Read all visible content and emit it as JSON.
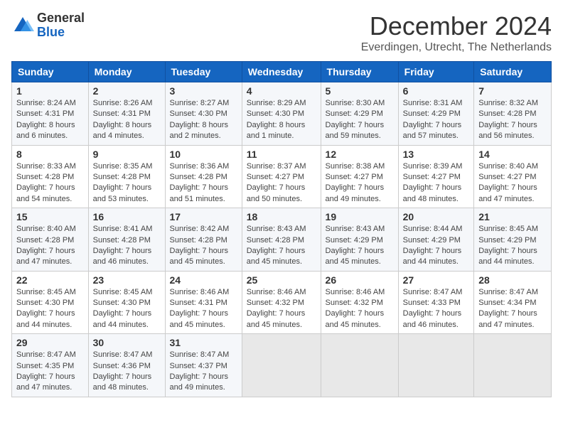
{
  "logo": {
    "general": "General",
    "blue": "Blue"
  },
  "title": "December 2024",
  "subtitle": "Everdingen, Utrecht, The Netherlands",
  "days_of_week": [
    "Sunday",
    "Monday",
    "Tuesday",
    "Wednesday",
    "Thursday",
    "Friday",
    "Saturday"
  ],
  "weeks": [
    [
      {
        "day": "1",
        "info": "Sunrise: 8:24 AM\nSunset: 4:31 PM\nDaylight: 8 hours\nand 6 minutes."
      },
      {
        "day": "2",
        "info": "Sunrise: 8:26 AM\nSunset: 4:31 PM\nDaylight: 8 hours\nand 4 minutes."
      },
      {
        "day": "3",
        "info": "Sunrise: 8:27 AM\nSunset: 4:30 PM\nDaylight: 8 hours\nand 2 minutes."
      },
      {
        "day": "4",
        "info": "Sunrise: 8:29 AM\nSunset: 4:30 PM\nDaylight: 8 hours\nand 1 minute."
      },
      {
        "day": "5",
        "info": "Sunrise: 8:30 AM\nSunset: 4:29 PM\nDaylight: 7 hours\nand 59 minutes."
      },
      {
        "day": "6",
        "info": "Sunrise: 8:31 AM\nSunset: 4:29 PM\nDaylight: 7 hours\nand 57 minutes."
      },
      {
        "day": "7",
        "info": "Sunrise: 8:32 AM\nSunset: 4:28 PM\nDaylight: 7 hours\nand 56 minutes."
      }
    ],
    [
      {
        "day": "8",
        "info": "Sunrise: 8:33 AM\nSunset: 4:28 PM\nDaylight: 7 hours\nand 54 minutes."
      },
      {
        "day": "9",
        "info": "Sunrise: 8:35 AM\nSunset: 4:28 PM\nDaylight: 7 hours\nand 53 minutes."
      },
      {
        "day": "10",
        "info": "Sunrise: 8:36 AM\nSunset: 4:28 PM\nDaylight: 7 hours\nand 51 minutes."
      },
      {
        "day": "11",
        "info": "Sunrise: 8:37 AM\nSunset: 4:27 PM\nDaylight: 7 hours\nand 50 minutes."
      },
      {
        "day": "12",
        "info": "Sunrise: 8:38 AM\nSunset: 4:27 PM\nDaylight: 7 hours\nand 49 minutes."
      },
      {
        "day": "13",
        "info": "Sunrise: 8:39 AM\nSunset: 4:27 PM\nDaylight: 7 hours\nand 48 minutes."
      },
      {
        "day": "14",
        "info": "Sunrise: 8:40 AM\nSunset: 4:27 PM\nDaylight: 7 hours\nand 47 minutes."
      }
    ],
    [
      {
        "day": "15",
        "info": "Sunrise: 8:40 AM\nSunset: 4:28 PM\nDaylight: 7 hours\nand 47 minutes."
      },
      {
        "day": "16",
        "info": "Sunrise: 8:41 AM\nSunset: 4:28 PM\nDaylight: 7 hours\nand 46 minutes."
      },
      {
        "day": "17",
        "info": "Sunrise: 8:42 AM\nSunset: 4:28 PM\nDaylight: 7 hours\nand 45 minutes."
      },
      {
        "day": "18",
        "info": "Sunrise: 8:43 AM\nSunset: 4:28 PM\nDaylight: 7 hours\nand 45 minutes."
      },
      {
        "day": "19",
        "info": "Sunrise: 8:43 AM\nSunset: 4:29 PM\nDaylight: 7 hours\nand 45 minutes."
      },
      {
        "day": "20",
        "info": "Sunrise: 8:44 AM\nSunset: 4:29 PM\nDaylight: 7 hours\nand 44 minutes."
      },
      {
        "day": "21",
        "info": "Sunrise: 8:45 AM\nSunset: 4:29 PM\nDaylight: 7 hours\nand 44 minutes."
      }
    ],
    [
      {
        "day": "22",
        "info": "Sunrise: 8:45 AM\nSunset: 4:30 PM\nDaylight: 7 hours\nand 44 minutes."
      },
      {
        "day": "23",
        "info": "Sunrise: 8:45 AM\nSunset: 4:30 PM\nDaylight: 7 hours\nand 44 minutes."
      },
      {
        "day": "24",
        "info": "Sunrise: 8:46 AM\nSunset: 4:31 PM\nDaylight: 7 hours\nand 45 minutes."
      },
      {
        "day": "25",
        "info": "Sunrise: 8:46 AM\nSunset: 4:32 PM\nDaylight: 7 hours\nand 45 minutes."
      },
      {
        "day": "26",
        "info": "Sunrise: 8:46 AM\nSunset: 4:32 PM\nDaylight: 7 hours\nand 45 minutes."
      },
      {
        "day": "27",
        "info": "Sunrise: 8:47 AM\nSunset: 4:33 PM\nDaylight: 7 hours\nand 46 minutes."
      },
      {
        "day": "28",
        "info": "Sunrise: 8:47 AM\nSunset: 4:34 PM\nDaylight: 7 hours\nand 47 minutes."
      }
    ],
    [
      {
        "day": "29",
        "info": "Sunrise: 8:47 AM\nSunset: 4:35 PM\nDaylight: 7 hours\nand 47 minutes."
      },
      {
        "day": "30",
        "info": "Sunrise: 8:47 AM\nSunset: 4:36 PM\nDaylight: 7 hours\nand 48 minutes."
      },
      {
        "day": "31",
        "info": "Sunrise: 8:47 AM\nSunset: 4:37 PM\nDaylight: 7 hours\nand 49 minutes."
      },
      {
        "day": "",
        "info": ""
      },
      {
        "day": "",
        "info": ""
      },
      {
        "day": "",
        "info": ""
      },
      {
        "day": "",
        "info": ""
      }
    ]
  ]
}
